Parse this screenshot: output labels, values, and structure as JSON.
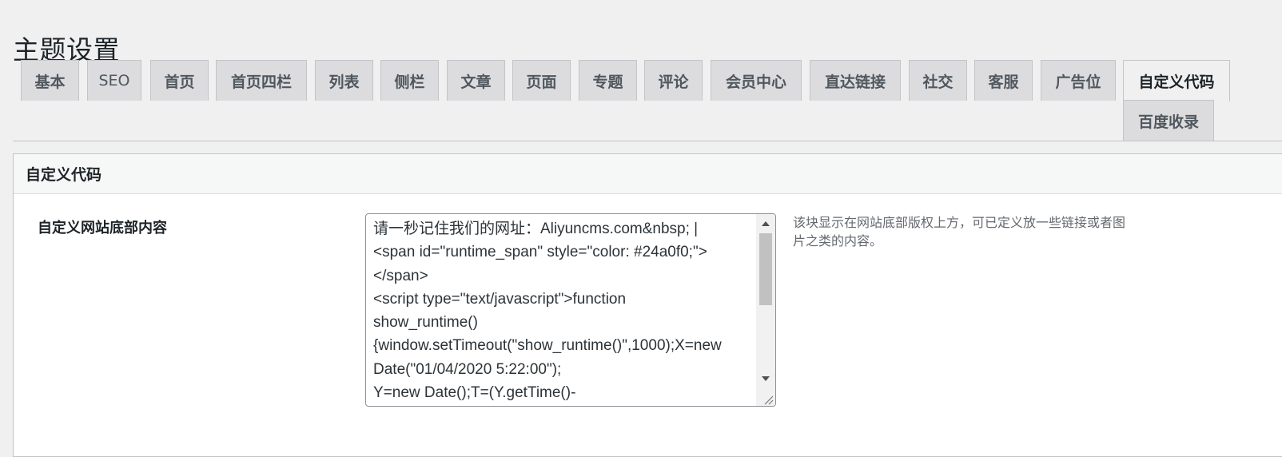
{
  "page": {
    "title": "主题设置"
  },
  "tabs": [
    {
      "label": "基本"
    },
    {
      "label": "SEO"
    },
    {
      "label": "首页"
    },
    {
      "label": "首页四栏"
    },
    {
      "label": "列表"
    },
    {
      "label": "侧栏"
    },
    {
      "label": "文章"
    },
    {
      "label": "页面"
    },
    {
      "label": "专题"
    },
    {
      "label": "评论"
    },
    {
      "label": "会员中心"
    },
    {
      "label": "直达链接"
    },
    {
      "label": "社交"
    },
    {
      "label": "客服"
    },
    {
      "label": "广告位"
    },
    {
      "label": "自定义代码",
      "active": true
    },
    {
      "label": "百度收录"
    }
  ],
  "panel": {
    "title": "自定义代码",
    "field": {
      "label": "自定义网站底部内容",
      "value": "请一秒记住我们的网址：Aliyuncms.com&nbsp; |\n<span id=\"runtime_span\" style=\"color: #24a0f0;\">\n</span>\n<script type=\"text/javascript\">function\nshow_runtime()\n{window.setTimeout(\"show_runtime()\",1000);X=new\nDate(\"01/04/2020 5:22:00\");\nY=new Date();T=(Y.getTime()-",
      "description": "该块显示在网站底部版权上方，可已定义放一些链接或者图片之类的内容。"
    }
  },
  "colors": {
    "background": "#f0f0f1",
    "tab_inactive": "#dcdcde",
    "border": "#c3c4c7",
    "description_text": "#646970"
  },
  "icons": {
    "scroll_up": "arrow-up-icon",
    "scroll_down": "arrow-down-icon",
    "resize": "resize-grip-icon"
  }
}
